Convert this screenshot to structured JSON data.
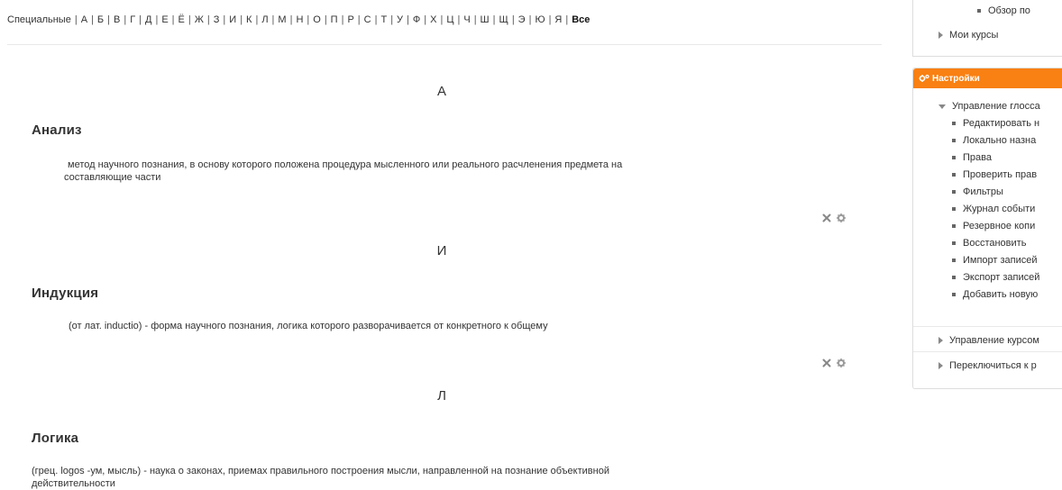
{
  "alphabet": {
    "special": "Специальные",
    "letters": [
      "А",
      "Б",
      "В",
      "Г",
      "Д",
      "Е",
      "Ё",
      "Ж",
      "З",
      "И",
      "К",
      "Л",
      "М",
      "Н",
      "О",
      "П",
      "Р",
      "С",
      "Т",
      "У",
      "Ф",
      "Х",
      "Ц",
      "Ч",
      "Ш",
      "Щ",
      "Э",
      "Ю",
      "Я"
    ],
    "all": "Все",
    "separator": "|"
  },
  "entries": [
    {
      "letter": "А",
      "term": "Анализ",
      "definition_lines": [
        "метод научного познания, в основу которого положена процедура мысленного или реального расчленения предмета на",
        "составляющие части"
      ]
    },
    {
      "letter": "И",
      "term": "Индукция",
      "definition_lines": [
        "(от лат. inductio) - форма научного познания, логика которого разворачивается от конкретного к общему"
      ]
    },
    {
      "letter": "Л",
      "term": "Логика",
      "definition_lines": [
        "(грец. logos -ум, мысль) - наука о законах, приемах правильного построения мысли, направленной на познание объективной",
        "действительности"
      ]
    }
  ],
  "entry_actions": {
    "delete_icon": "close-icon",
    "edit_icon": "gear-icon"
  },
  "nav_block": {
    "overview_item": "Обзор по",
    "my_courses": "Мои курсы"
  },
  "settings_block": {
    "title": "Настройки",
    "header_color": "#f98012",
    "glossary_admin": "Управление глосса",
    "items": [
      "Редактировать н",
      "Локально назна",
      "Права",
      "Проверить прав",
      "Фильтры",
      "Журнал событи",
      "Резервное копи",
      "Восстановить",
      "Импорт записей",
      "Экспорт записей",
      "Добавить новую"
    ],
    "course_admin": "Управление курсом",
    "switch_role": "Переключиться к р"
  }
}
